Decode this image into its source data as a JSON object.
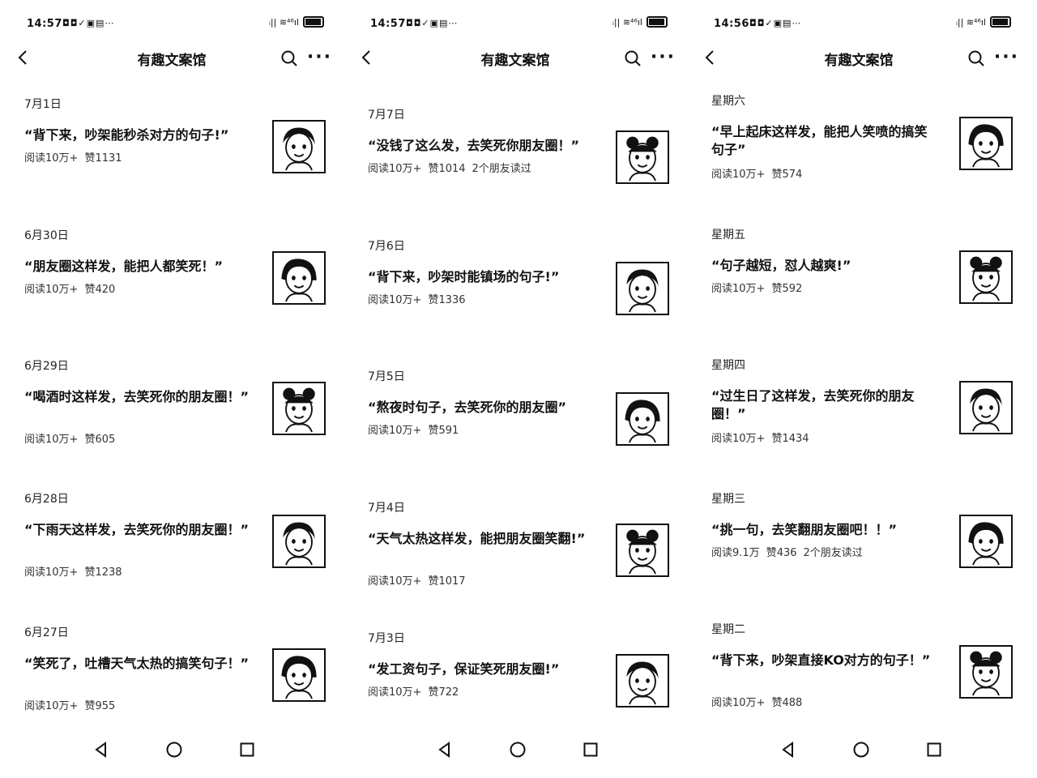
{
  "phones": [
    {
      "time": "14:57",
      "title": "有趣文案馆",
      "articles": [
        {
          "date": "7月1日",
          "title": "“背下来，吵架能秒杀对方的句子!”",
          "reads": "阅读10万+",
          "likes": "赞1131",
          "friends": ""
        },
        {
          "date": "6月30日",
          "title": "“朋友圈这样发，能把人都笑死！”",
          "reads": "阅读10万+",
          "likes": "赞420",
          "friends": ""
        },
        {
          "date": "6月29日",
          "title": "“喝酒时这样发，去笑死你的朋友圈！”",
          "reads": "阅读10万+",
          "likes": "赞605",
          "friends": ""
        },
        {
          "date": "6月28日",
          "title": "“下雨天这样发，去笑死你的朋友圈！”",
          "reads": "阅读10万+",
          "likes": "赞1238",
          "friends": ""
        },
        {
          "date": "6月27日",
          "title": "“笑死了，吐槽天气太热的搞笑句子！”",
          "reads": "阅读10万+",
          "likes": "赞955",
          "friends": ""
        }
      ]
    },
    {
      "time": "14:57",
      "title": "有趣文案馆",
      "articles": [
        {
          "date": "7月7日",
          "title": "“没钱了这么发，去笑死你朋友圈！”",
          "reads": "阅读10万+",
          "likes": "赞1014",
          "friends": "2个朋友读过"
        },
        {
          "date": "7月6日",
          "title": "“背下来，吵架时能镇场的句子!”",
          "reads": "阅读10万+",
          "likes": "赞1336",
          "friends": ""
        },
        {
          "date": "7月5日",
          "title": "“熬夜时句子，去笑死你的朋友圈”",
          "reads": "阅读10万+",
          "likes": "赞591",
          "friends": ""
        },
        {
          "date": "7月4日",
          "title": "“天气太热这样发，能把朋友圈笑翻!”",
          "reads": "阅读10万+",
          "likes": "赞1017",
          "friends": ""
        },
        {
          "date": "7月3日",
          "title": "“发工资句子，保证笑死朋友圈!”",
          "reads": "阅读10万+",
          "likes": "赞722",
          "friends": ""
        }
      ]
    },
    {
      "time": "14:56",
      "title": "有趣文案馆",
      "articles": [
        {
          "date": "星期六",
          "title": "“早上起床这样发，能把人笑喷的搞笑句子”",
          "reads": "阅读10万+",
          "likes": "赞574",
          "friends": ""
        },
        {
          "date": "星期五",
          "title": "“句子越短，怼人越爽!”",
          "reads": "阅读10万+",
          "likes": "赞592",
          "friends": ""
        },
        {
          "date": "星期四",
          "title": "“过生日了这样发，去笑死你的朋友圈！”",
          "reads": "阅读10万+",
          "likes": "赞1434",
          "friends": ""
        },
        {
          "date": "星期三",
          "title": "“挑一句，去笑翻朋友圈吧！！”",
          "reads": "阅读9.1万",
          "likes": "赞436",
          "friends": "2个朋友读过"
        },
        {
          "date": "星期二",
          "title": "“背下来，吵架直接KO对方的句子！”",
          "reads": "阅读10万+",
          "likes": "赞488",
          "friends": ""
        }
      ]
    }
  ]
}
